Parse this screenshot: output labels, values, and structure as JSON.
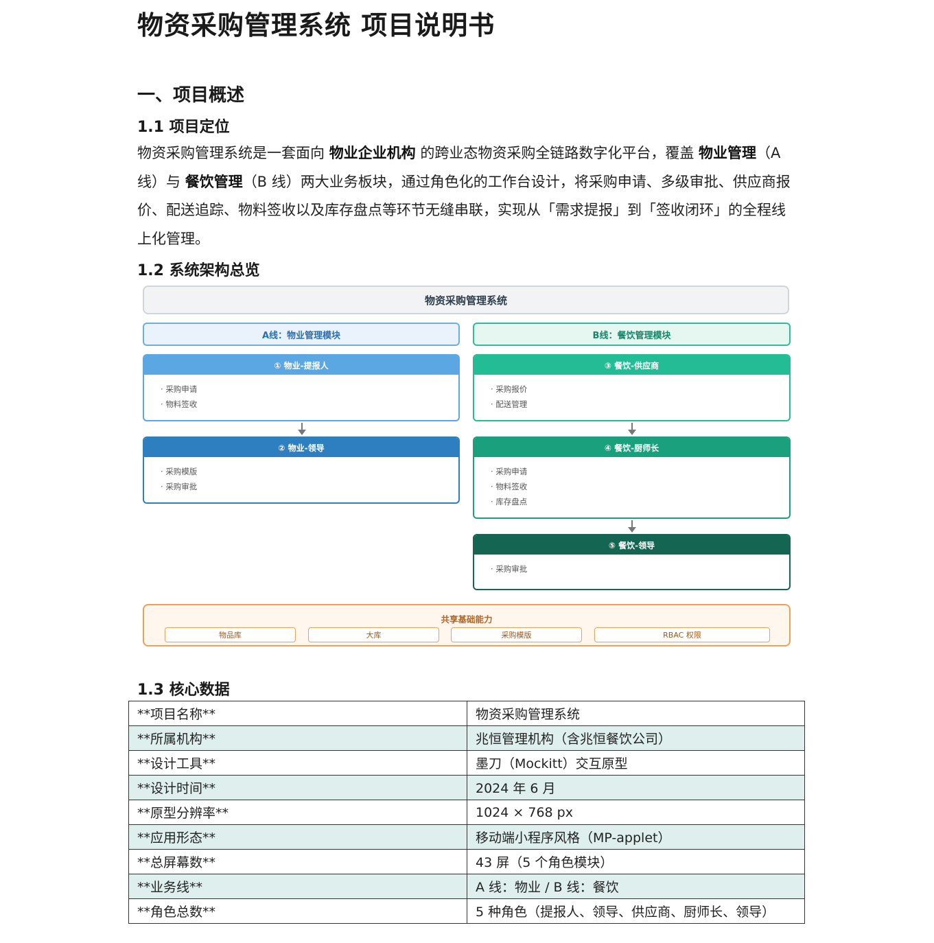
{
  "doc": {
    "title": "物资采购管理系统 项目说明书"
  },
  "section1": {
    "heading": "一、项目概述",
    "sub1": {
      "heading": "1.1 项目定位",
      "p": [
        "物资采购管理系统是一套面向 ",
        "物业企业机构",
        " 的跨业态物资采购全链路数字化平台，覆盖 ",
        "物业管理",
        "（A 线）与 ",
        "餐饮管理",
        "（B 线）两大业务板块，通过角色化的工作台设计，将采购申请、多级审批、供应商报价、配送追踪、物料签收以及库存盘点等环节无缝串联，实现从「需求提报」到「签收闭环」的全程线上化管理。"
      ]
    },
    "sub2": {
      "heading": "1.2 系统架构总览"
    },
    "sub3": {
      "heading": "1.3 核心数据"
    }
  },
  "diagram": {
    "system": "物资采购管理系统",
    "line_a": "A线：物业管理模块",
    "line_b": "B线：餐饮管理模块",
    "roles": [
      {
        "title": "① 物业-提报人",
        "items": [
          "采购申请",
          "物料签收"
        ],
        "color": "#5aa7e3"
      },
      {
        "title": "② 物业-领导",
        "items": [
          "采购模版",
          "采购审批"
        ],
        "color": "#2e7fbf"
      },
      {
        "title": "③ 餐饮-供应商",
        "items": [
          "采购报价",
          "配送管理"
        ],
        "color": "#22bc95"
      },
      {
        "title": "④ 餐饮-厨师长",
        "items": [
          "采购申请",
          "物料签收",
          "库存盘点"
        ],
        "color": "#1aa07d"
      },
      {
        "title": "⑤ 餐饮-领导",
        "items": [
          "采购审批"
        ],
        "color": "#146652"
      }
    ],
    "shared": {
      "title": "共享基础能力",
      "chips": [
        "物品库",
        "大库",
        "采购模版",
        "RBAC 权限"
      ]
    }
  },
  "core_table": [
    [
      "**项目名称**",
      "物资采购管理系统"
    ],
    [
      "**所属机构**",
      "兆恒管理机构（含兆恒餐饮公司）"
    ],
    [
      "**设计工具**",
      "墨刀（Mockitt）交互原型"
    ],
    [
      "**设计时间**",
      "2024 年 6 月"
    ],
    [
      "**原型分辨率**",
      "1024 × 768 px"
    ],
    [
      "**应用形态**",
      "移动端小程序风格（MP-applet）"
    ],
    [
      "**总屏幕数**",
      "43 屏（5 个角色模块）"
    ],
    [
      "**业务线**",
      "A 线：物业 / B 线：餐饮"
    ],
    [
      "**角色总数**",
      "5 种角色（提报人、领导、供应商、厨师长、领导）"
    ]
  ]
}
